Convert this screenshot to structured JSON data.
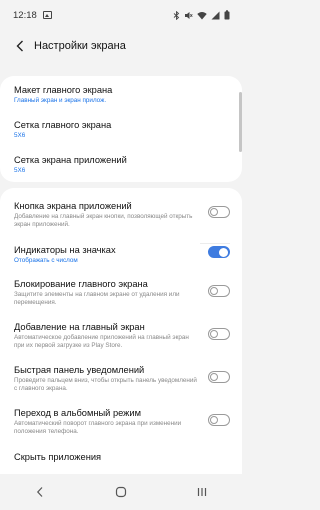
{
  "status_bar": {
    "time": "12:18"
  },
  "header": {
    "title": "Настройки экрана"
  },
  "group1": [
    {
      "title": "Макет главного экрана",
      "subtitle": "Главный экран и экран прилож."
    },
    {
      "title": "Сетка главного экрана",
      "subtitle": "5X6"
    },
    {
      "title": "Сетка экрана приложений",
      "subtitle": "5X6"
    }
  ],
  "group2": [
    {
      "title": "Кнопка экрана приложений",
      "subtitle": "Добавление на главный экран кнопки, позволяющей открыть экран приложений.",
      "toggle": false
    },
    {
      "title": "Индикаторы на значках",
      "subtitle": "Отображать с числом",
      "toggle": true
    },
    {
      "title": "Блокирование главного экрана",
      "subtitle": "Защитите элементы на главном экране от удаления или перемещения.",
      "toggle": false
    },
    {
      "title": "Добавление на главный экран",
      "subtitle": "Автоматическое добавление приложений на главный экран при их первой загрузке из Play Store.",
      "toggle": false
    },
    {
      "title": "Быстрая панель уведомлений",
      "subtitle": "Проведите пальцем вниз, чтобы открыть панель уведомлений с главного экрана.",
      "toggle": false
    },
    {
      "title": "Переход в альбомный режим",
      "subtitle": "Автоматический поворот главного экрана при изменении положения телефона.",
      "toggle": false
    },
    {
      "title": "Скрыть приложения"
    }
  ],
  "colors": {
    "accent": "#3f7ce0",
    "link_blue": "#1a73e8",
    "background": "#f3f3f3"
  }
}
